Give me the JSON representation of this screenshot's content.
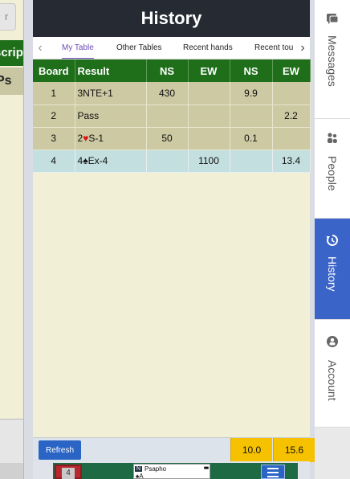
{
  "left_panel": {
    "input_text": "r",
    "green_header_text": "script",
    "tab_text": "Ps"
  },
  "history": {
    "title": "History",
    "tabs": [
      "My Table",
      "Other Tables",
      "Recent hands",
      "Recent tou"
    ],
    "active_tab": "My Table",
    "columns": [
      "Board",
      "Result",
      "NS",
      "EW",
      "NS",
      "EW"
    ],
    "rows": [
      {
        "board": "1",
        "result": "3NTE+1",
        "suit": "",
        "ns": "430",
        "ew": "",
        "ns_mp": "9.9",
        "ew_mp": ""
      },
      {
        "board": "2",
        "result": "Pass",
        "suit": "",
        "ns": "",
        "ew": "",
        "ns_mp": "",
        "ew_mp": "2.2"
      },
      {
        "board": "3",
        "result": "2",
        "suit": "♥",
        "result_rest": "S-1",
        "ns": "50",
        "ew": "",
        "ns_mp": "0.1",
        "ew_mp": ""
      },
      {
        "board": "4",
        "result": "4",
        "suit": "♠",
        "result_rest": "Ex-4",
        "ns": "",
        "ew": "1100",
        "ns_mp": "",
        "ew_mp": "13.4"
      }
    ],
    "refresh_label": "Refresh",
    "total_ns": "10.0",
    "total_ew": "15.6"
  },
  "game_strip": {
    "card_label": "4",
    "seat": "N",
    "player_name": "Psapho",
    "visible_card": "♠A",
    "mini_marks": "■■"
  },
  "sidebar": {
    "items": [
      {
        "label": "Messages",
        "icon": "messages-icon",
        "active": false
      },
      {
        "label": "People",
        "icon": "people-icon",
        "active": false
      },
      {
        "label": "History",
        "icon": "history-icon",
        "active": true
      },
      {
        "label": "Account",
        "icon": "account-icon",
        "active": false
      }
    ]
  },
  "colors": {
    "header_dark": "#262a33",
    "table_green": "#1f6e1a",
    "row_tan": "#ccc9a3",
    "row_selected": "#c3dfe0",
    "panel_bg": "#f1efd6",
    "accent_blue": "#3b64c8",
    "total_yellow": "#f6c200",
    "tab_purple": "#6d4bb5"
  }
}
